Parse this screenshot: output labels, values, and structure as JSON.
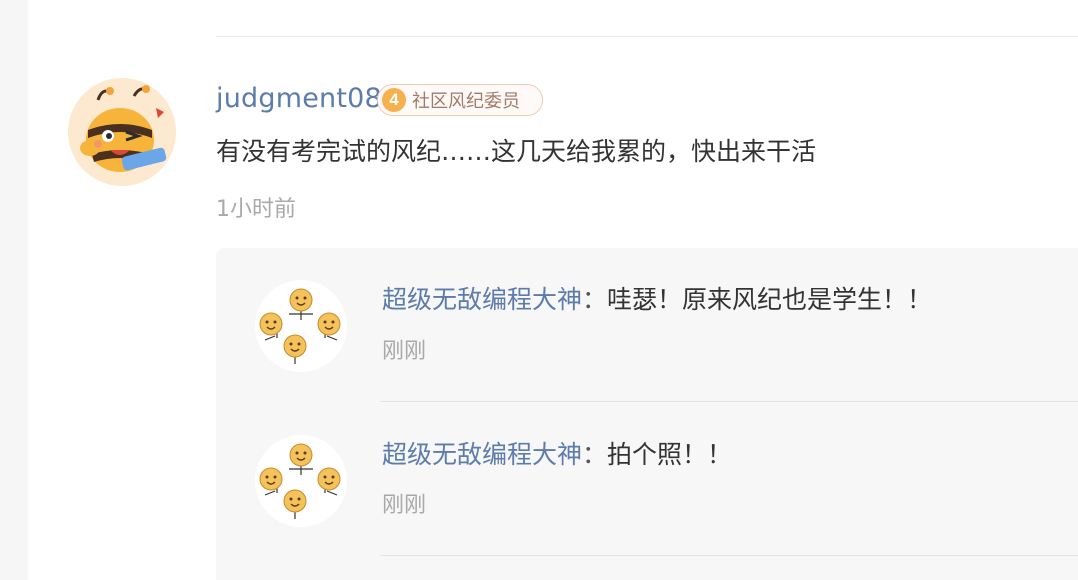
{
  "comment": {
    "username": "judgment08",
    "badge": {
      "level": "4",
      "title": "社区风纪委员"
    },
    "text": "有没有考完试的风纪……这几天给我累的，快出来干活",
    "time": "1小时前"
  },
  "replies": [
    {
      "author": "超级无敌编程大神",
      "separator": "：",
      "text": "哇瑟！原来风纪也是学生！！",
      "time": "刚刚"
    },
    {
      "author": "超级无敌编程大神",
      "separator": "：",
      "text": "拍个照！！",
      "time": "刚刚"
    }
  ],
  "colors": {
    "link": "#5d7cab",
    "text": "#333333",
    "muted": "#a9a9a9",
    "badge_accent": "#f6b04e"
  },
  "icons": {
    "comment_avatar": "cartoon-bee-avatar",
    "reply_avatar": "smiley-group-avatar"
  }
}
